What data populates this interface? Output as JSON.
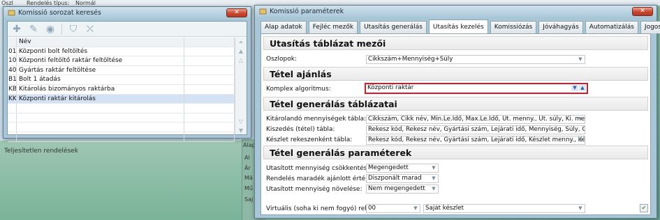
{
  "background": {
    "top_label_1": "Oszl",
    "top_label_2": "Rendelés típus:",
    "top_value": "Normál",
    "bottom_text": "Teljesítetlen rendelések",
    "side_labels": [
      "Alap",
      "Al",
      "Ár",
      "Má",
      "Mű",
      "Saj"
    ]
  },
  "left_window": {
    "title": "Komissió sorozat keresés",
    "toolbar_icons": [
      "add-icon",
      "edit-icon",
      "view-icon",
      "filter-icon",
      "clear-filter-icon"
    ],
    "column_header": "Név",
    "rows": [
      {
        "code": "01",
        "name": "Központi bolt feltöltés"
      },
      {
        "code": "10",
        "name": "Központi feltöltő raktár feltöltése"
      },
      {
        "code": "40",
        "name": "Gyártás raktár feltöltése"
      },
      {
        "code": "B1",
        "name": "Bolt 1 átadás"
      },
      {
        "code": "KB",
        "name": "Kitárolás bizományos raktárba"
      },
      {
        "code": "KK",
        "name": "Központi raktár kitárolás"
      }
    ],
    "selected_row": 5
  },
  "right_window": {
    "title": "Komissió paraméterek",
    "tabs": [
      "Alap adatok",
      "Fejléc mezők",
      "Utasítás generálás",
      "Utasítás kezelés",
      "Komissiózás",
      "Jóváhagyás",
      "Automatizálás",
      "Jogosultságok"
    ],
    "active_tab": 3,
    "sections": {
      "s1": "Utasítás táblázat mezői",
      "s2": "Tétel ajánlás",
      "s3": "Tétel generálás táblázatai",
      "s4": "Tétel generálás paraméterek"
    },
    "oszlopok_label": "Oszlopok:",
    "oszlopok_value": "Cikkszám+Mennyiség+Súly",
    "komplex_label": "Komplex algoritmus:",
    "komplex_value": "Központi raktár",
    "kitar_label": "Kitárolandó mennyiségek tábla:",
    "kitar_value": "Cikkszám, Cikk név, Min.Le.Idő, Max.Le.Idő, Ut. menny., Ut. súly, Ki. menny.,",
    "kiszedes_label": "Kiszedés (tétel) tábla:",
    "kiszedes_value": "Rekesz kód, Rekesz név, Gyártási szám, Lejárati idő, Mennyiség, Súly, Cikks",
    "keszlet_label": "Készlet rekeszenként tábla:",
    "keszlet_value": "Rekesz kód, Rekesz név, Gyártási szám, Lejárati idő, Készlet menny., Készle",
    "csokk_label": "Utasított mennyiség csökkentése:",
    "csokk_value": "Megengedett",
    "maradek_label": "Rendelés maradék ajánlott értéke:",
    "maradek_value": "Diszponált marad",
    "novel_label": "Utasított mennyiség növelése:",
    "novel_value": "Nem megengedett",
    "virt_label": "Virtuális (soha ki nem fogyó) rekesz:",
    "virt_code": "00",
    "virt_name": "Saját készlet"
  },
  "colors": {
    "highlight": "#d9182a",
    "selected_row": "#d4e2f4"
  }
}
